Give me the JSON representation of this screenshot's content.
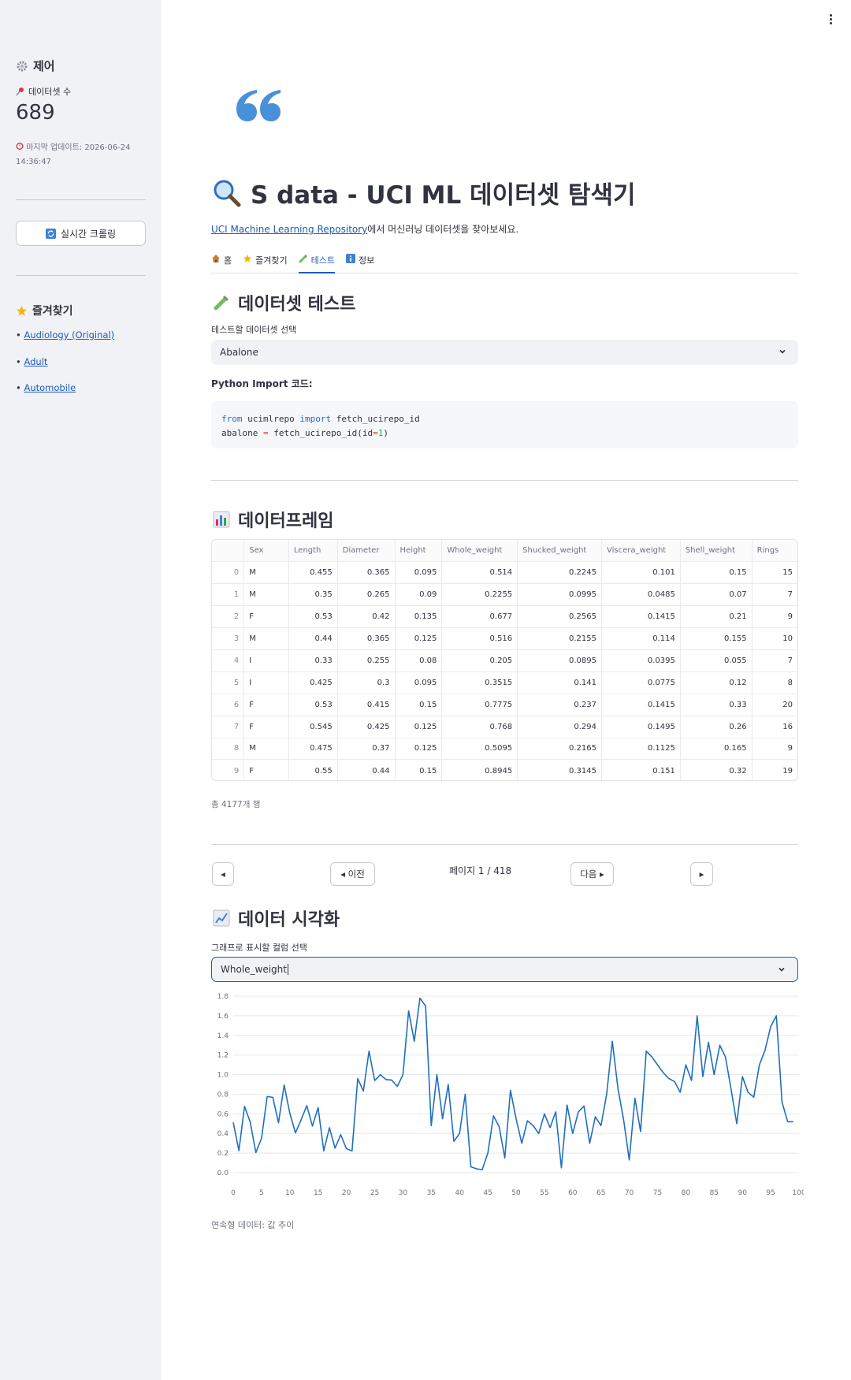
{
  "sidebar": {
    "title": "제어",
    "count_label": "데이터셋 수",
    "count_value": "689",
    "update_text": "마지막 업데이트: 2026-06-24 14:36:47",
    "scroll_button": "실시간 크롤링",
    "favorites_title": "즐겨찾기",
    "favorites": [
      "Audiology (Original)",
      "Adult",
      "Automobile"
    ]
  },
  "header": {
    "title": "S data - UCI ML 데이터셋 탐색기",
    "subtitle_link": "UCI Machine Learning Repository",
    "subtitle_rest": "에서 머신러닝 데이터셋을 찾아보세요."
  },
  "tabs": [
    {
      "label": "홈",
      "icon": "house-icon",
      "active": false
    },
    {
      "label": "즐겨찾기",
      "icon": "star-icon",
      "active": false
    },
    {
      "label": "테스트",
      "icon": "test-tube-icon",
      "active": true
    },
    {
      "label": "정보",
      "icon": "info-icon",
      "active": false
    }
  ],
  "test_section": {
    "heading": "데이터셋 테스트",
    "select_label": "테스트할 데이터셋 선택",
    "selected_dataset": "Abalone",
    "import_label": "Python Import 코드:",
    "code_line1_kw1": "from",
    "code_line1_mod": " ucimlrepo ",
    "code_line1_kw2": "import",
    "code_line1_fn": " fetch_ucirepo_id",
    "code_line2_var": "abalone ",
    "code_line2_op": "=",
    "code_line2_call": " fetch_ucirepo_id(id",
    "code_line2_op2": "=",
    "code_line2_num": "1",
    "code_line2_end": ")"
  },
  "dataframe": {
    "heading": "데이터프레임",
    "columns": [
      "",
      "Sex",
      "Length",
      "Diameter",
      "Height",
      "Whole_weight",
      "Shucked_weight",
      "Viscera_weight",
      "Shell_weight",
      "Rings"
    ],
    "rows": [
      [
        "0",
        "M",
        "0.455",
        "0.365",
        "0.095",
        "0.514",
        "0.2245",
        "0.101",
        "0.15",
        "15"
      ],
      [
        "1",
        "M",
        "0.35",
        "0.265",
        "0.09",
        "0.2255",
        "0.0995",
        "0.0485",
        "0.07",
        "7"
      ],
      [
        "2",
        "F",
        "0.53",
        "0.42",
        "0.135",
        "0.677",
        "0.2565",
        "0.1415",
        "0.21",
        "9"
      ],
      [
        "3",
        "M",
        "0.44",
        "0.365",
        "0.125",
        "0.516",
        "0.2155",
        "0.114",
        "0.155",
        "10"
      ],
      [
        "4",
        "I",
        "0.33",
        "0.255",
        "0.08",
        "0.205",
        "0.0895",
        "0.0395",
        "0.055",
        "7"
      ],
      [
        "5",
        "I",
        "0.425",
        "0.3",
        "0.095",
        "0.3515",
        "0.141",
        "0.0775",
        "0.12",
        "8"
      ],
      [
        "6",
        "F",
        "0.53",
        "0.415",
        "0.15",
        "0.7775",
        "0.237",
        "0.1415",
        "0.33",
        "20"
      ],
      [
        "7",
        "F",
        "0.545",
        "0.425",
        "0.125",
        "0.768",
        "0.294",
        "0.1495",
        "0.26",
        "16"
      ],
      [
        "8",
        "M",
        "0.475",
        "0.37",
        "0.125",
        "0.5095",
        "0.2165",
        "0.1125",
        "0.165",
        "9"
      ],
      [
        "9",
        "F",
        "0.55",
        "0.44",
        "0.15",
        "0.8945",
        "0.3145",
        "0.151",
        "0.32",
        "19"
      ]
    ],
    "total_text": "총 4177개 행"
  },
  "pagination": {
    "first": "◂",
    "prev": "◂ 이전",
    "page_text": "페이지 1 / 418",
    "next": "다음 ▸",
    "last": "▸"
  },
  "viz": {
    "heading": "데이터 시각화",
    "select_label": "그래프로 표시할 컬럼 선택",
    "selected_column": "Whole_weight",
    "caption": "연속형 데이터: 값 추이"
  },
  "colors": {
    "accent": "#1c5bb8",
    "line": "#1f6fbf",
    "sidebar_bg": "#f0f2f6"
  },
  "chart_data": {
    "type": "line",
    "x_ticks": [
      "0",
      "5",
      "10",
      "15",
      "20",
      "25",
      "30",
      "35",
      "40",
      "45",
      "50",
      "55",
      "60",
      "65",
      "70",
      "75",
      "80",
      "85",
      "90",
      "95",
      "100"
    ],
    "y_ticks": [
      "0.0",
      "0.2",
      "0.4",
      "0.6",
      "0.8",
      "1.0",
      "1.2",
      "1.4",
      "1.6",
      "1.8"
    ],
    "xlim": [
      0,
      100
    ],
    "ylim": [
      0,
      1.8
    ],
    "x": [
      0,
      1,
      2,
      3,
      4,
      5,
      6,
      7,
      8,
      9,
      10,
      11,
      12,
      13,
      14,
      15,
      16,
      17,
      18,
      19,
      20,
      21,
      22,
      23,
      24,
      25,
      26,
      27,
      28,
      29,
      30,
      31,
      32,
      33,
      34,
      35,
      36,
      37,
      38,
      39,
      40,
      41,
      42,
      43,
      44,
      45,
      46,
      47,
      48,
      49,
      50,
      51,
      52,
      53,
      54,
      55,
      56,
      57,
      58,
      59,
      60,
      61,
      62,
      63,
      64,
      65,
      66,
      67,
      68,
      69,
      70,
      71,
      72,
      73,
      74,
      75,
      76,
      77,
      78,
      79,
      80,
      81,
      82,
      83,
      84,
      85,
      86,
      87,
      88,
      89,
      90,
      91,
      92,
      93,
      94,
      95,
      96,
      97,
      98,
      99
    ],
    "values": [
      0.514,
      0.2255,
      0.677,
      0.516,
      0.205,
      0.3515,
      0.7775,
      0.768,
      0.5095,
      0.8945,
      0.6065,
      0.406,
      0.5405,
      0.6845,
      0.4755,
      0.6645,
      0.2225,
      0.459,
      0.2505,
      0.3885,
      0.245,
      0.2225,
      0.9595,
      0.833,
      1.239,
      0.94,
      1.0,
      0.95,
      0.945,
      0.88,
      1.0,
      1.65,
      1.34,
      1.78,
      1.7,
      0.48,
      1.0,
      0.55,
      0.9,
      0.32,
      0.4,
      0.8,
      0.06,
      0.04,
      0.03,
      0.2,
      0.58,
      0.47,
      0.15,
      0.84,
      0.55,
      0.3,
      0.53,
      0.48,
      0.4,
      0.6,
      0.46,
      0.62,
      0.05,
      0.69,
      0.4,
      0.62,
      0.68,
      0.3,
      0.57,
      0.48,
      0.8,
      1.34,
      0.86,
      0.54,
      0.13,
      0.76,
      0.42,
      1.24,
      1.18,
      1.1,
      1.02,
      0.96,
      0.93,
      0.82,
      1.1,
      0.94,
      1.6,
      0.98,
      1.33,
      1.0,
      1.3,
      1.18,
      0.85,
      0.5,
      0.98,
      0.82,
      0.77,
      1.1,
      1.25,
      1.49,
      1.6,
      0.72,
      0.52,
      0.52,
      0.58
    ],
    "xlabel": "",
    "ylabel": ""
  }
}
